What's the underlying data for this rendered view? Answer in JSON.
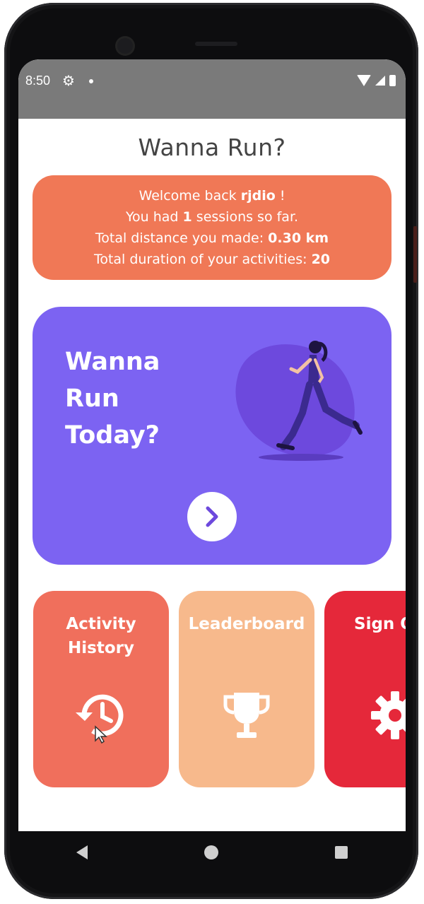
{
  "status": {
    "time": "8:50"
  },
  "app": {
    "title": "Wanna Run?"
  },
  "welcome": {
    "line1_prefix": "Welcome back ",
    "username": "rjdio",
    "line1_suffix": " !",
    "line2_prefix": "You had ",
    "sessions": "1",
    "line2_suffix": " sessions so far.",
    "line3_prefix": "Total distance you made: ",
    "distance": "0.30 km",
    "line4_prefix": "Total duration of your activities: ",
    "duration": "20"
  },
  "run_card": {
    "line1": "Wanna",
    "line2": "Run",
    "line3": "Today?"
  },
  "tiles": [
    {
      "label_line1": "Activity",
      "label_line2": "History",
      "icon": "history-icon",
      "color": "#f06f5c"
    },
    {
      "label_line1": "Leaderboard",
      "label_line2": "",
      "icon": "trophy-icon",
      "color": "#f7b98c"
    },
    {
      "label_line1": "Sign O",
      "label_line2": "",
      "icon": "gear-icon",
      "color": "#e5283a"
    }
  ],
  "colors": {
    "welcome_bg": "#f07856",
    "run_card_bg": "#7c63f2",
    "status_bar": "#7a7a7a"
  }
}
